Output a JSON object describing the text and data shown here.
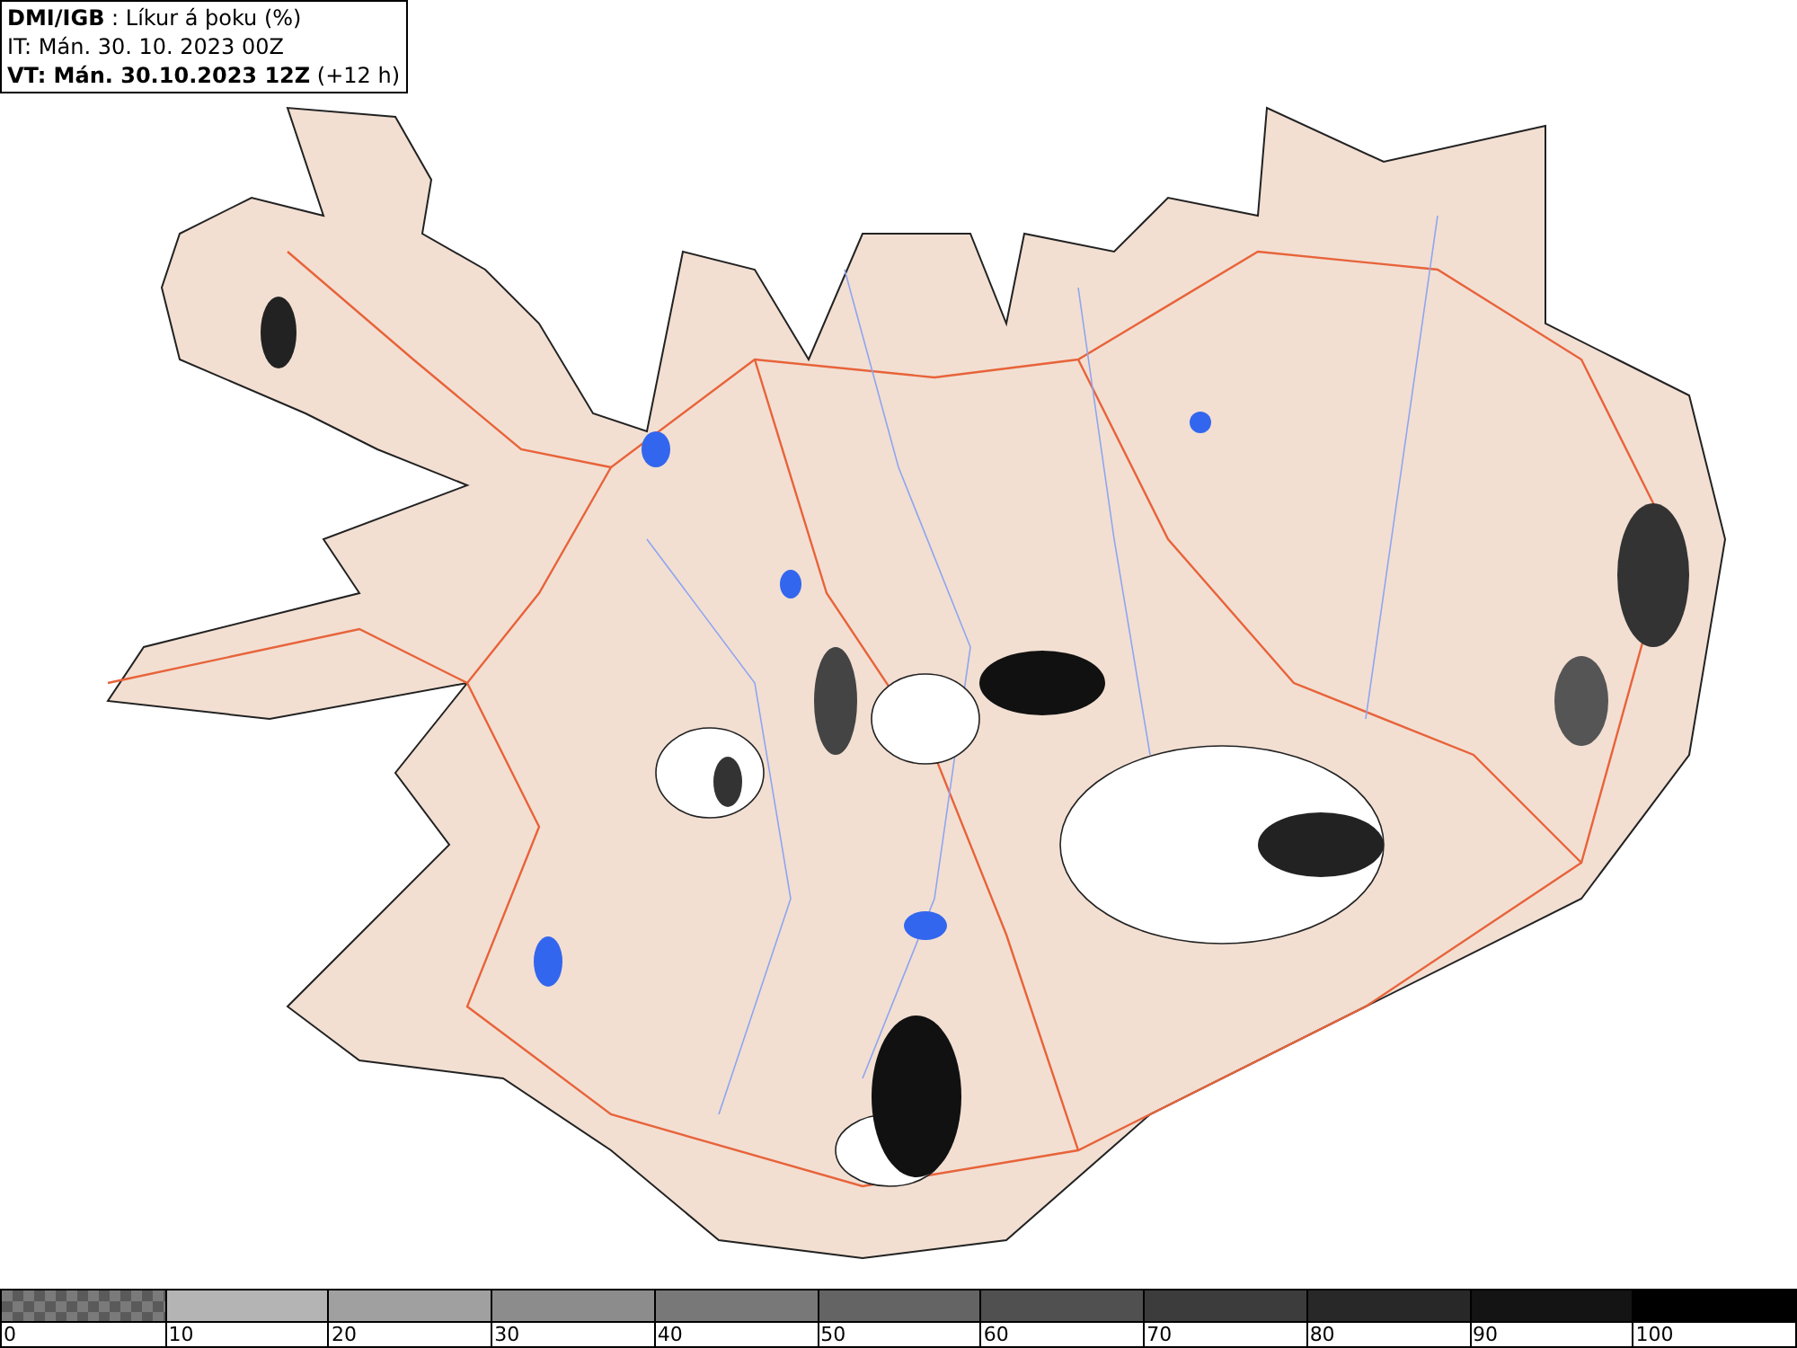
{
  "info_box": {
    "lines": [
      "**DMI/IGB** : Líkur á þoku (%)",
      "IT: Mán. 30. 10. 2023 00Z",
      "**VT: Mán. 30.10.2023 12Z** (+12 h)"
    ]
  },
  "legend": {
    "bins": [
      {
        "label": "0",
        "color": "#7a7a7a",
        "kind": "checker"
      },
      {
        "label": "10",
        "color": "#b4b4b4",
        "kind": "solid"
      },
      {
        "label": "20",
        "color": "#a0a0a0",
        "kind": "solid"
      },
      {
        "label": "30",
        "color": "#8c8c8c",
        "kind": "solid"
      },
      {
        "label": "40",
        "color": "#787878",
        "kind": "solid"
      },
      {
        "label": "50",
        "color": "#646464",
        "kind": "solid"
      },
      {
        "label": "60",
        "color": "#505050",
        "kind": "solid"
      },
      {
        "label": "70",
        "color": "#3c3c3c",
        "kind": "solid"
      },
      {
        "label": "80",
        "color": "#282828",
        "kind": "solid"
      },
      {
        "label": "90",
        "color": "#141414",
        "kind": "solid"
      },
      {
        "label": "100",
        "color": "#000000",
        "kind": "solid"
      }
    ]
  }
}
